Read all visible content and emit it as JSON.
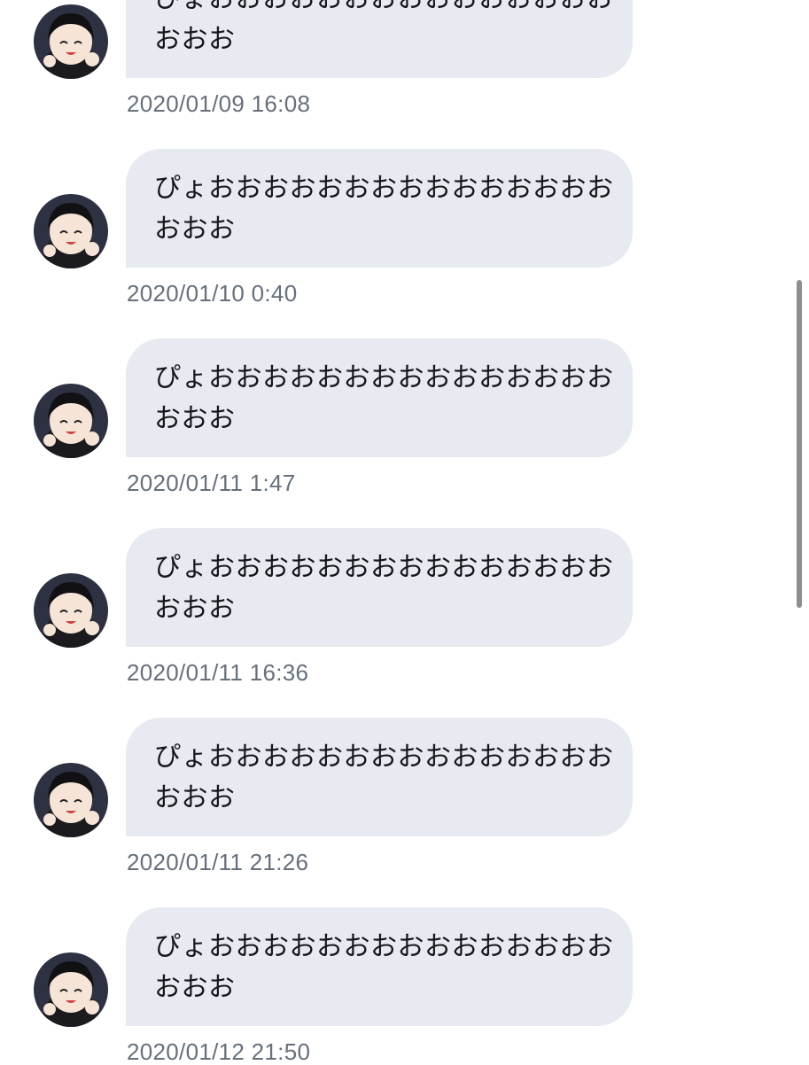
{
  "messages": [
    {
      "text": "ぴょおおおおおおおおおおおおおおおおおお",
      "timestamp": "2020/01/09 16:08",
      "avatar_alt": "user-avatar"
    },
    {
      "text": "ぴょおおおおおおおおおおおおおおおおおお",
      "timestamp": "2020/01/10 0:40",
      "avatar_alt": "user-avatar"
    },
    {
      "text": "ぴょおおおおおおおおおおおおおおおおおお",
      "timestamp": "2020/01/11 1:47",
      "avatar_alt": "user-avatar"
    },
    {
      "text": "ぴょおおおおおおおおおおおおおおおおおお",
      "timestamp": "2020/01/11 16:36",
      "avatar_alt": "user-avatar"
    },
    {
      "text": "ぴょおおおおおおおおおおおおおおおおおお",
      "timestamp": "2020/01/11 21:26",
      "avatar_alt": "user-avatar"
    },
    {
      "text": "ぴょおおおおおおおおおおおおおおおおおお",
      "timestamp": "2020/01/12 21:50",
      "avatar_alt": "user-avatar"
    }
  ],
  "colors": {
    "bubble_background": "#e7eaf1",
    "message_text": "#14171a",
    "timestamp_text": "#66707b",
    "scrollbar": "#8d8d92"
  }
}
